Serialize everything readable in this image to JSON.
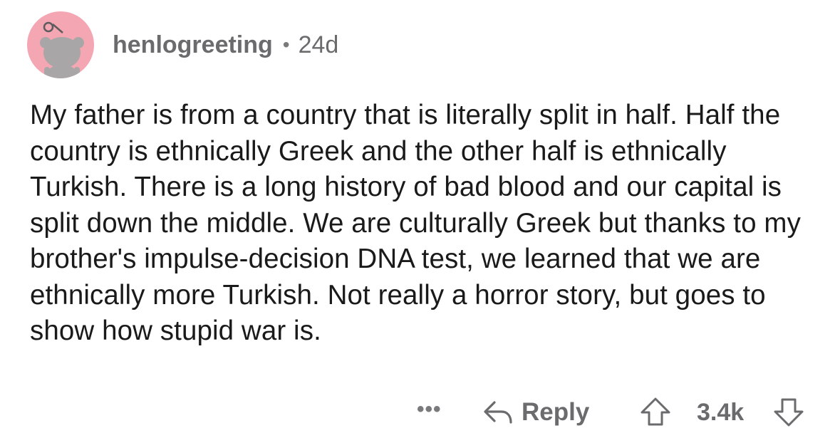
{
  "comment": {
    "author": "henlogreeting",
    "separator": "•",
    "age": "24d",
    "body": "My father is from a country that is literally split in half. Half the country is ethnically Greek and the other half is ethnically Turkish. There is a long history of bad blood and our capital is split down the middle. We are culturally Greek but thanks to my brother's impulse-decision DNA test, we learned that we are ethnically more Turkish. Not really a horror story, but goes to show how stupid war is.",
    "avatar_icon": "snoo-avatar-icon",
    "avatar_bg": "#f4a6b2"
  },
  "actions": {
    "more_label": "•••",
    "reply_label": "Reply",
    "reply_icon": "reply-arrow-icon",
    "upvote_icon": "upvote-arrow-icon",
    "score": "3.4k",
    "downvote_icon": "downvote-arrow-icon"
  }
}
